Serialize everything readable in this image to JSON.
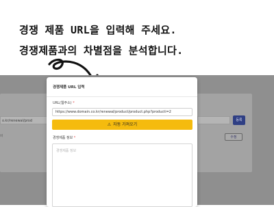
{
  "headline": {
    "line1": "경쟁 제품 URL을 입력해 주세요.",
    "line2": "경쟁제품과의 차별점을 분석합니다."
  },
  "background": {
    "url_fragment": "o.kr/renewal/prod",
    "register_label": "등록",
    "small_label": "비",
    "edit_label": "수정"
  },
  "modal": {
    "title": "경쟁제품 URL 입력",
    "url_label": "URL(웹주소)",
    "required_mark": "*",
    "url_value": "https://www.domain.co.kr/renewal/product/product.php?producti=2",
    "fetch_button_label": "자동 가져오기",
    "info_label": "경쟁제품 정보",
    "info_placeholder": "경쟁제품 정보"
  },
  "colors": {
    "accent_button": "#f5bb0e",
    "register_button": "#2f3f84",
    "required": "#e04646"
  }
}
